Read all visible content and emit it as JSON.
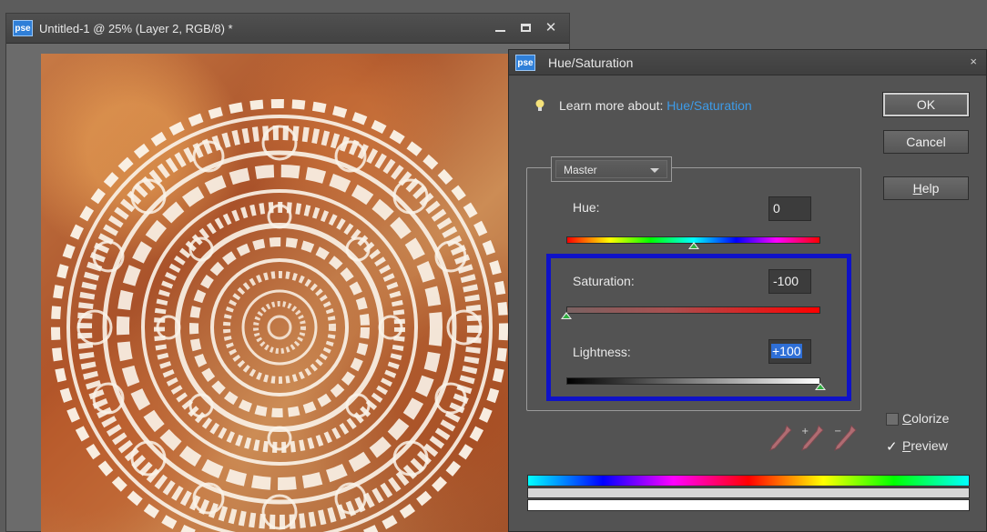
{
  "document": {
    "logo": "pse",
    "title": "Untitled-1 @ 25% (Layer 2, RGB/8) *",
    "close_glyph": "✕"
  },
  "dialog": {
    "logo": "pse",
    "title": "Hue/Saturation",
    "close_glyph": "×",
    "learn_prefix": "Learn more about:",
    "learn_link": "Hue/Saturation",
    "buttons": {
      "ok": "OK",
      "cancel": "Cancel",
      "help_rest": "elp",
      "help_mnemonic": "H"
    },
    "channel": {
      "selected": "Master"
    },
    "hue": {
      "label": "Hue:",
      "value": "0",
      "position": 0.5
    },
    "saturation": {
      "label": "Saturation:",
      "value": "-100",
      "position": 0.0
    },
    "lightness": {
      "label": "Lightness:",
      "value": "+100",
      "position": 1.0
    },
    "colorize": {
      "mnemonic": "C",
      "rest": "olorize",
      "checked": false
    },
    "preview": {
      "mnemonic": "P",
      "rest": "review",
      "checked": true
    },
    "icons": [
      "bulb-icon",
      "eyedropper-icon",
      "eyedropper-plus-icon",
      "eyedropper-minus-icon",
      "chevron-down-icon"
    ],
    "colors": {
      "highlight": "#0f12c8",
      "link": "#3d9be8",
      "thumb_fill": "#2fb040"
    }
  }
}
